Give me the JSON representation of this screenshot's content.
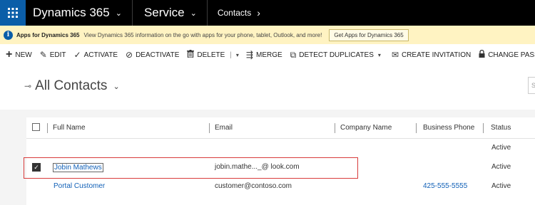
{
  "topbar": {
    "app_name": "Dynamics 365",
    "area_name": "Service",
    "entity_name": "Contacts",
    "chevron": "⌄",
    "crumb_arrow": "›",
    "waffle_icon": "waffle-icon",
    "bar_color": "#000000",
    "waffle_color": "#0b5ea8"
  },
  "notification": {
    "icon": "i",
    "title": "Apps for Dynamics 365",
    "message": "View Dynamics 365 information on the go with apps for your phone, tablet, Outlook, and more!",
    "button_label": "Get Apps for Dynamics 365",
    "bg_color": "#fff3c2"
  },
  "commands": [
    {
      "icon": "+",
      "label": "NEW"
    },
    {
      "icon": "✎",
      "label": "EDIT"
    },
    {
      "icon": "✓",
      "label": "ACTIVATE"
    },
    {
      "icon": "⊘",
      "label": "DEACTIVATE"
    },
    {
      "icon": "🗑",
      "label": "DELETE"
    },
    {
      "icon": "⇶",
      "label": "MERGE"
    },
    {
      "icon": "⧉",
      "label": "DETECT DUPLICATES"
    },
    {
      "icon": "✉",
      "label": "CREATE INVITATION"
    },
    {
      "icon": "🔒",
      "label": "CHANGE PASSWORD"
    }
  ],
  "command_separator": "|",
  "command_dropdown": "▾",
  "view": {
    "pin_icon": "⊸",
    "title": "All Contacts",
    "chevron": "⌄",
    "search_placeholder": "S"
  },
  "grid": {
    "columns": [
      "Full Name",
      "Email",
      "Company Name",
      "Business Phone",
      "Status"
    ],
    "rows": [
      {
        "full_name": "",
        "email": "",
        "company": "",
        "phone": "",
        "status": "Active",
        "selected": false
      },
      {
        "full_name": "Jobin Mathews",
        "email": "jobin.mathe..._@    look.com",
        "company": "",
        "phone": "",
        "status": "Active",
        "selected": true
      },
      {
        "full_name": "Portal Customer",
        "email": "customer@contoso.com",
        "company": "",
        "phone": "425-555-5555",
        "status": "Active",
        "selected": false
      }
    ],
    "checkmark": "✓"
  },
  "colors": {
    "link": "#1160b7",
    "highlight": "#d83b3b"
  }
}
